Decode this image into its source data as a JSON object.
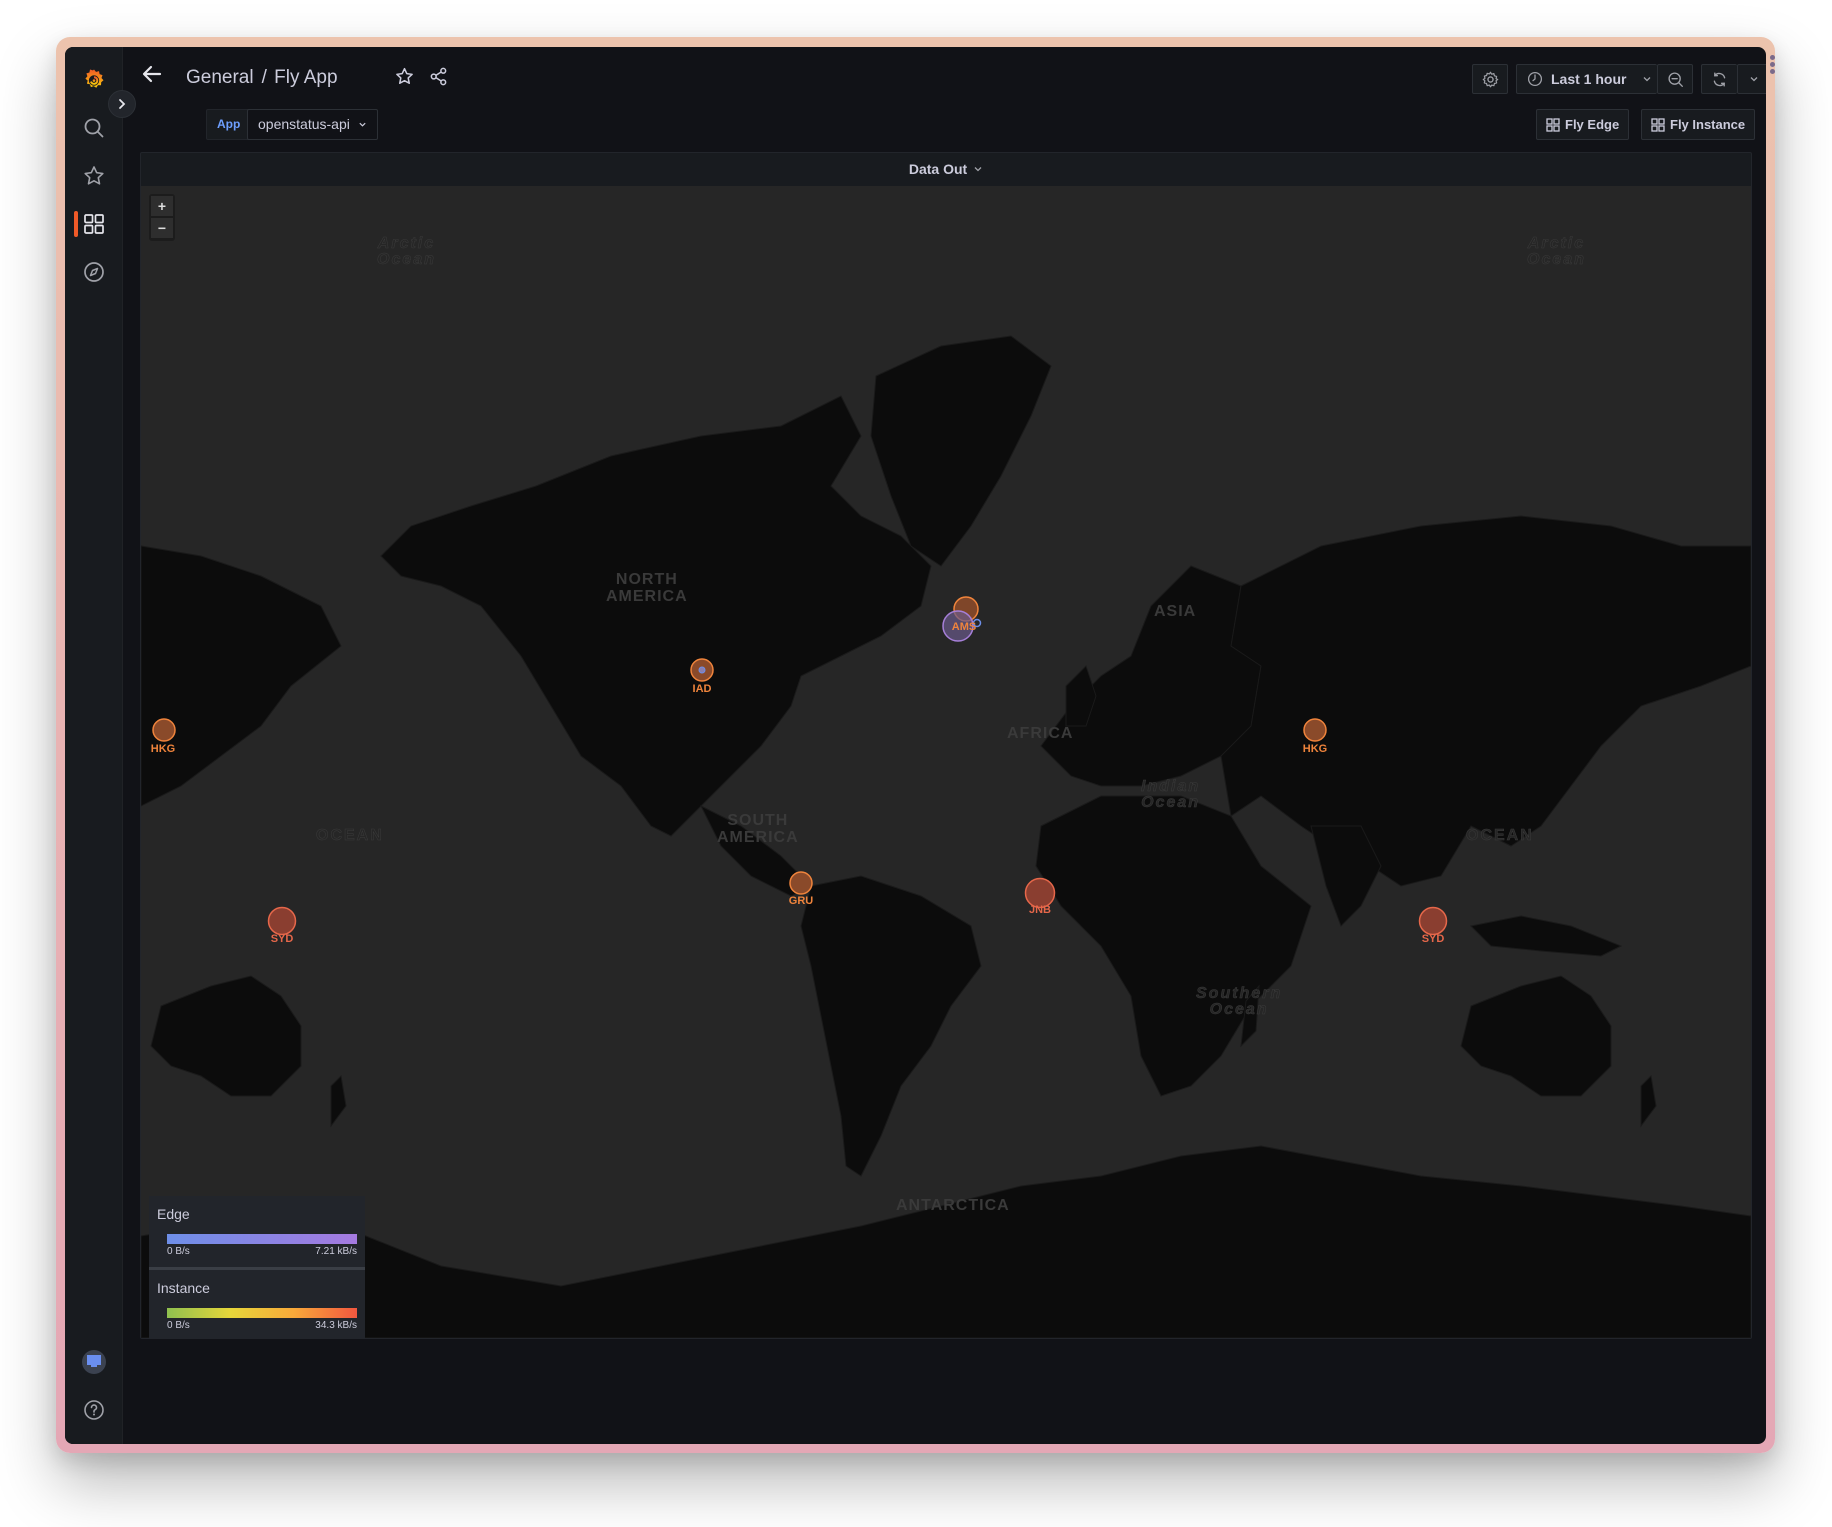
{
  "header": {
    "breadcrumb_folder": "General",
    "breadcrumb_separator": "/",
    "dashboard_title": "Fly App",
    "time_range": "Last 1 hour"
  },
  "sidebar": {
    "items": [
      {
        "name": "search",
        "icon": "search-icon"
      },
      {
        "name": "starred",
        "icon": "star-icon"
      },
      {
        "name": "dashboards",
        "icon": "dashboards-icon",
        "active": true
      },
      {
        "name": "explore",
        "icon": "compass-icon"
      }
    ],
    "bottom": [
      {
        "name": "profile",
        "icon": "avatar"
      },
      {
        "name": "help",
        "icon": "help-icon"
      }
    ]
  },
  "variables": {
    "label": "App",
    "value": "openstatus-api"
  },
  "links": [
    {
      "label": "Fly Edge",
      "icon": "dashboard-grid-icon"
    },
    {
      "label": "Fly Instance",
      "icon": "dashboard-grid-icon"
    }
  ],
  "panel": {
    "title": "Data Out",
    "zoom_in": "+",
    "zoom_out": "−"
  },
  "map": {
    "place_labels": [
      {
        "text": "NORTH\nAMERICA"
      },
      {
        "text": "SOUTH\nAMERICA"
      },
      {
        "text": "AFRICA"
      },
      {
        "text": "ASIA"
      },
      {
        "text": "ANTARCTICA"
      }
    ],
    "ocean_labels": [
      {
        "text": "Arctic\nOcean"
      },
      {
        "text": "Arctic\nOcean"
      },
      {
        "text": "OCEAN"
      },
      {
        "text": "OCEAN"
      },
      {
        "text": "Indian\nOcean"
      },
      {
        "text": "Southern\nOcean"
      }
    ],
    "markers": [
      {
        "code": "IAD",
        "layer": "instance"
      },
      {
        "code": "AMS",
        "layer": "instance"
      },
      {
        "code": "AMS",
        "layer": "edge"
      },
      {
        "code": "HKG",
        "layer": "instance"
      },
      {
        "code": "HKG",
        "layer": "instance"
      },
      {
        "code": "GRU",
        "layer": "instance"
      },
      {
        "code": "JNB",
        "layer": "instance"
      },
      {
        "code": "SYD",
        "layer": "instance"
      },
      {
        "code": "SYD",
        "layer": "instance"
      }
    ]
  },
  "legend": {
    "edge": {
      "title": "Edge",
      "min": "0 B/s",
      "max": "7.21 kB/s",
      "colors": [
        "#6e8fe8",
        "#a57ae0"
      ]
    },
    "instance": {
      "title": "Instance",
      "min": "0 B/s",
      "max": "34.3 kB/s",
      "colors": [
        "#8fc04f",
        "#e6d63a",
        "#f8a93a",
        "#f2573f"
      ]
    }
  },
  "colors": {
    "brand": "#f05a28",
    "accent_blue": "#6e9fff",
    "marker_orange": "#f0843c",
    "marker_red": "#e6674a",
    "marker_purple": "#a67fd8"
  }
}
